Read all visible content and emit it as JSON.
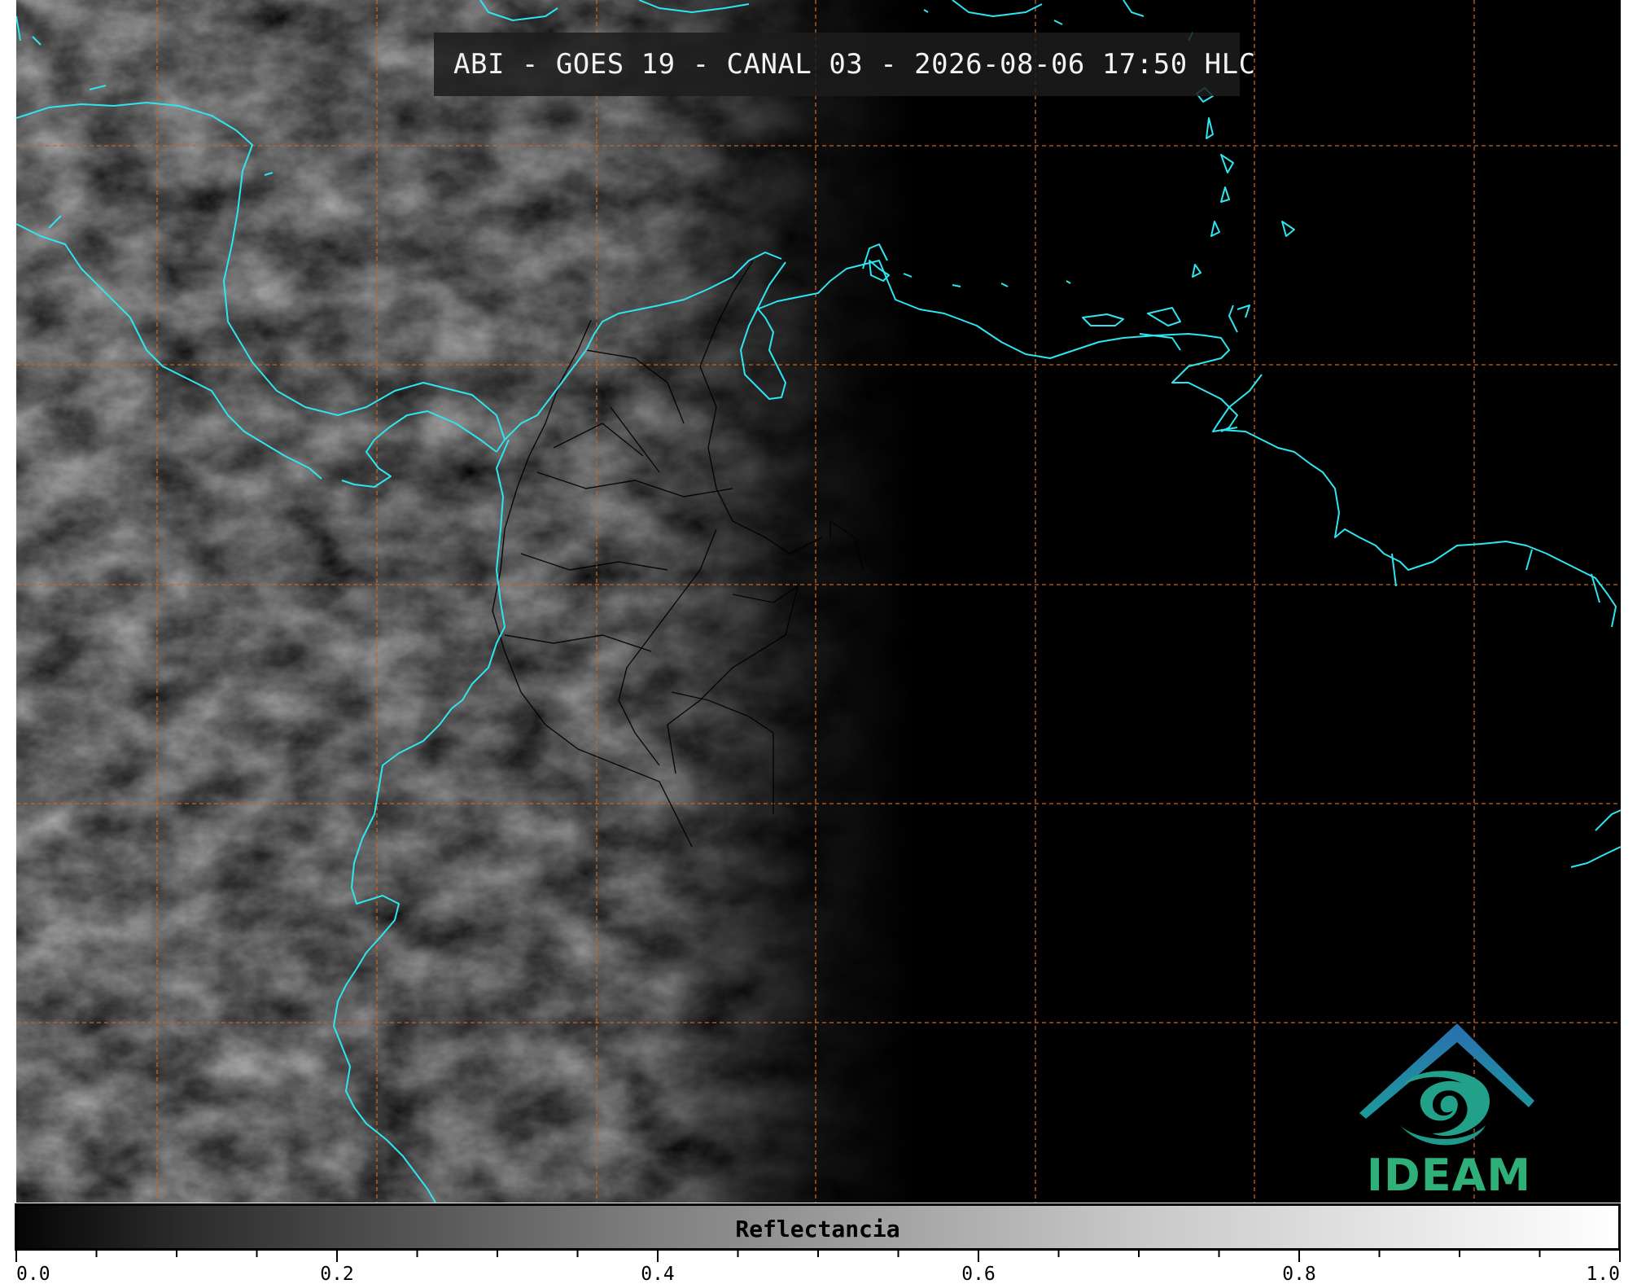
{
  "title": "ABI - GOES 19 - CANAL 03 - 2026-08-06 17:50 HLC",
  "colorbar": {
    "label": "Reflectancia",
    "min": 0.0,
    "max": 1.0,
    "major_ticks": [
      "0.0",
      "0.2",
      "0.4",
      "0.6",
      "0.8",
      "1.0"
    ],
    "minor_step": 0.05
  },
  "logo": {
    "text": "IDEAM",
    "colors": {
      "roof": "#2a7fb0",
      "swirl": "#22a08a",
      "text": "#2fb079"
    }
  },
  "colors": {
    "coastline": "#2ee6f0",
    "gridlines": "#c8641e",
    "borders": "#000000"
  },
  "gridlines": {
    "style": "dashed",
    "vertical_count": 7,
    "horizontal_count": 5
  }
}
